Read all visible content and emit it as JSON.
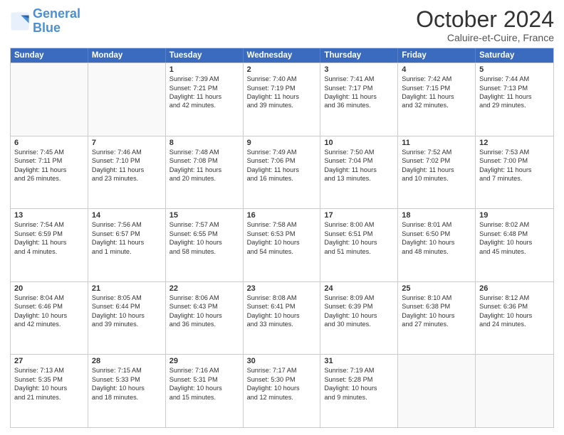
{
  "logo": {
    "line1": "General",
    "line2": "Blue"
  },
  "title": "October 2024",
  "location": "Caluire-et-Cuire, France",
  "header_days": [
    "Sunday",
    "Monday",
    "Tuesday",
    "Wednesday",
    "Thursday",
    "Friday",
    "Saturday"
  ],
  "rows": [
    [
      {
        "day": "",
        "lines": [],
        "empty": true
      },
      {
        "day": "",
        "lines": [],
        "empty": true
      },
      {
        "day": "1",
        "lines": [
          "Sunrise: 7:39 AM",
          "Sunset: 7:21 PM",
          "Daylight: 11 hours",
          "and 42 minutes."
        ]
      },
      {
        "day": "2",
        "lines": [
          "Sunrise: 7:40 AM",
          "Sunset: 7:19 PM",
          "Daylight: 11 hours",
          "and 39 minutes."
        ]
      },
      {
        "day": "3",
        "lines": [
          "Sunrise: 7:41 AM",
          "Sunset: 7:17 PM",
          "Daylight: 11 hours",
          "and 36 minutes."
        ]
      },
      {
        "day": "4",
        "lines": [
          "Sunrise: 7:42 AM",
          "Sunset: 7:15 PM",
          "Daylight: 11 hours",
          "and 32 minutes."
        ]
      },
      {
        "day": "5",
        "lines": [
          "Sunrise: 7:44 AM",
          "Sunset: 7:13 PM",
          "Daylight: 11 hours",
          "and 29 minutes."
        ]
      }
    ],
    [
      {
        "day": "6",
        "lines": [
          "Sunrise: 7:45 AM",
          "Sunset: 7:11 PM",
          "Daylight: 11 hours",
          "and 26 minutes."
        ]
      },
      {
        "day": "7",
        "lines": [
          "Sunrise: 7:46 AM",
          "Sunset: 7:10 PM",
          "Daylight: 11 hours",
          "and 23 minutes."
        ]
      },
      {
        "day": "8",
        "lines": [
          "Sunrise: 7:48 AM",
          "Sunset: 7:08 PM",
          "Daylight: 11 hours",
          "and 20 minutes."
        ]
      },
      {
        "day": "9",
        "lines": [
          "Sunrise: 7:49 AM",
          "Sunset: 7:06 PM",
          "Daylight: 11 hours",
          "and 16 minutes."
        ]
      },
      {
        "day": "10",
        "lines": [
          "Sunrise: 7:50 AM",
          "Sunset: 7:04 PM",
          "Daylight: 11 hours",
          "and 13 minutes."
        ]
      },
      {
        "day": "11",
        "lines": [
          "Sunrise: 7:52 AM",
          "Sunset: 7:02 PM",
          "Daylight: 11 hours",
          "and 10 minutes."
        ]
      },
      {
        "day": "12",
        "lines": [
          "Sunrise: 7:53 AM",
          "Sunset: 7:00 PM",
          "Daylight: 11 hours",
          "and 7 minutes."
        ]
      }
    ],
    [
      {
        "day": "13",
        "lines": [
          "Sunrise: 7:54 AM",
          "Sunset: 6:59 PM",
          "Daylight: 11 hours",
          "and 4 minutes."
        ]
      },
      {
        "day": "14",
        "lines": [
          "Sunrise: 7:56 AM",
          "Sunset: 6:57 PM",
          "Daylight: 11 hours",
          "and 1 minute."
        ]
      },
      {
        "day": "15",
        "lines": [
          "Sunrise: 7:57 AM",
          "Sunset: 6:55 PM",
          "Daylight: 10 hours",
          "and 58 minutes."
        ]
      },
      {
        "day": "16",
        "lines": [
          "Sunrise: 7:58 AM",
          "Sunset: 6:53 PM",
          "Daylight: 10 hours",
          "and 54 minutes."
        ]
      },
      {
        "day": "17",
        "lines": [
          "Sunrise: 8:00 AM",
          "Sunset: 6:51 PM",
          "Daylight: 10 hours",
          "and 51 minutes."
        ]
      },
      {
        "day": "18",
        "lines": [
          "Sunrise: 8:01 AM",
          "Sunset: 6:50 PM",
          "Daylight: 10 hours",
          "and 48 minutes."
        ]
      },
      {
        "day": "19",
        "lines": [
          "Sunrise: 8:02 AM",
          "Sunset: 6:48 PM",
          "Daylight: 10 hours",
          "and 45 minutes."
        ]
      }
    ],
    [
      {
        "day": "20",
        "lines": [
          "Sunrise: 8:04 AM",
          "Sunset: 6:46 PM",
          "Daylight: 10 hours",
          "and 42 minutes."
        ]
      },
      {
        "day": "21",
        "lines": [
          "Sunrise: 8:05 AM",
          "Sunset: 6:44 PM",
          "Daylight: 10 hours",
          "and 39 minutes."
        ]
      },
      {
        "day": "22",
        "lines": [
          "Sunrise: 8:06 AM",
          "Sunset: 6:43 PM",
          "Daylight: 10 hours",
          "and 36 minutes."
        ]
      },
      {
        "day": "23",
        "lines": [
          "Sunrise: 8:08 AM",
          "Sunset: 6:41 PM",
          "Daylight: 10 hours",
          "and 33 minutes."
        ]
      },
      {
        "day": "24",
        "lines": [
          "Sunrise: 8:09 AM",
          "Sunset: 6:39 PM",
          "Daylight: 10 hours",
          "and 30 minutes."
        ]
      },
      {
        "day": "25",
        "lines": [
          "Sunrise: 8:10 AM",
          "Sunset: 6:38 PM",
          "Daylight: 10 hours",
          "and 27 minutes."
        ]
      },
      {
        "day": "26",
        "lines": [
          "Sunrise: 8:12 AM",
          "Sunset: 6:36 PM",
          "Daylight: 10 hours",
          "and 24 minutes."
        ]
      }
    ],
    [
      {
        "day": "27",
        "lines": [
          "Sunrise: 7:13 AM",
          "Sunset: 5:35 PM",
          "Daylight: 10 hours",
          "and 21 minutes."
        ]
      },
      {
        "day": "28",
        "lines": [
          "Sunrise: 7:15 AM",
          "Sunset: 5:33 PM",
          "Daylight: 10 hours",
          "and 18 minutes."
        ]
      },
      {
        "day": "29",
        "lines": [
          "Sunrise: 7:16 AM",
          "Sunset: 5:31 PM",
          "Daylight: 10 hours",
          "and 15 minutes."
        ]
      },
      {
        "day": "30",
        "lines": [
          "Sunrise: 7:17 AM",
          "Sunset: 5:30 PM",
          "Daylight: 10 hours",
          "and 12 minutes."
        ]
      },
      {
        "day": "31",
        "lines": [
          "Sunrise: 7:19 AM",
          "Sunset: 5:28 PM",
          "Daylight: 10 hours",
          "and 9 minutes."
        ]
      },
      {
        "day": "",
        "lines": [],
        "empty": true
      },
      {
        "day": "",
        "lines": [],
        "empty": true
      }
    ]
  ]
}
